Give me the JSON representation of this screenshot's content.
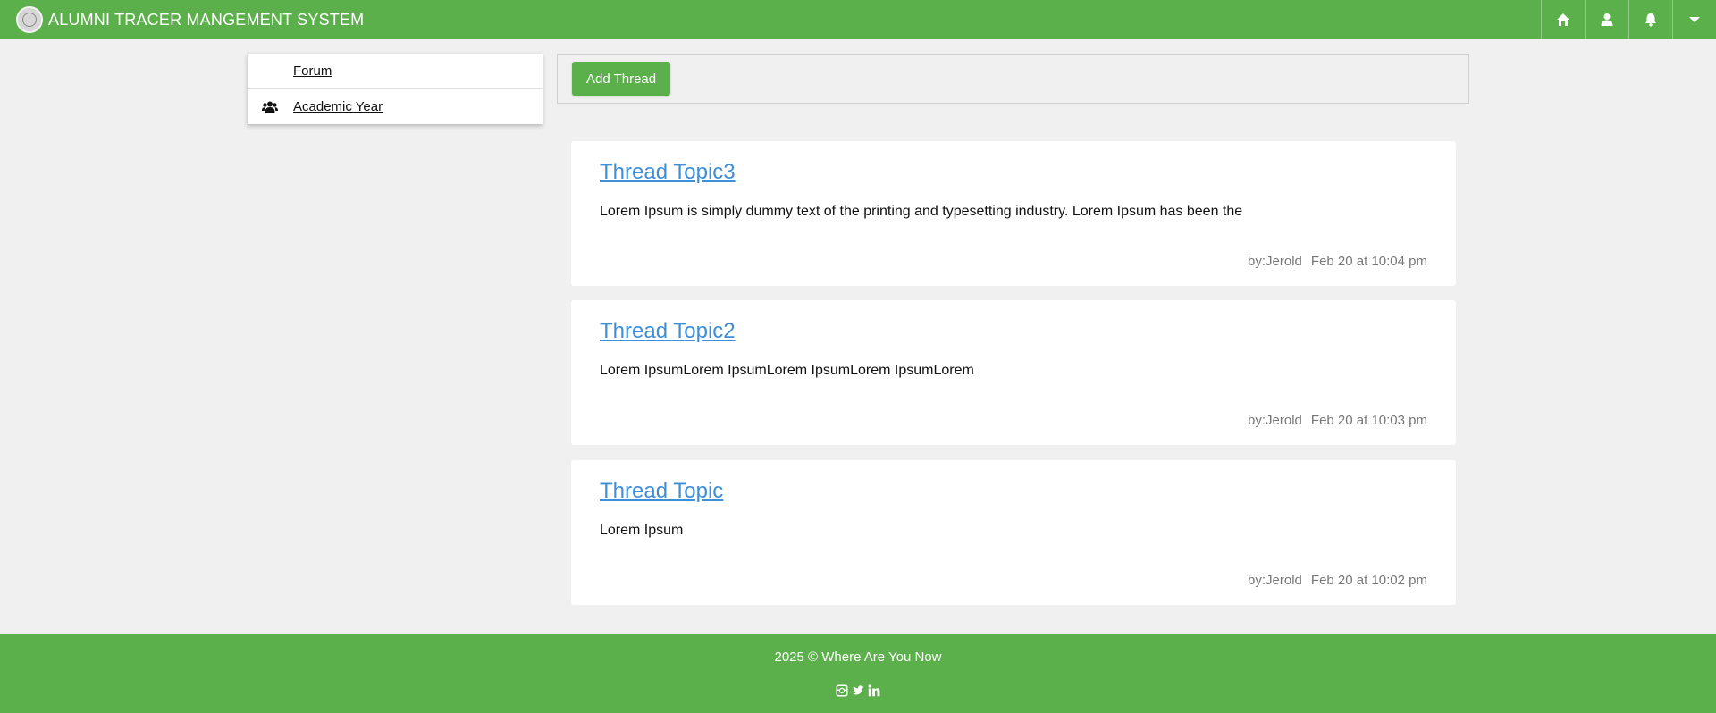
{
  "header": {
    "title": "ALUMNI TRACER MANGEMENT SYSTEM",
    "brand_color": "#5cb04b",
    "icons": [
      "home-icon",
      "user-icon",
      "bell-icon",
      "caret-down-icon"
    ]
  },
  "sidebar": {
    "items": [
      {
        "label": "Forum",
        "icon": ""
      },
      {
        "label": "Academic Year",
        "icon": "users-icon"
      }
    ]
  },
  "toolbar": {
    "add_thread_label": "Add Thread"
  },
  "threads": [
    {
      "title": "Thread Topic3",
      "body": "Lorem Ipsum is simply dummy text of the printing and typesetting industry. Lorem Ipsum has been the",
      "author": "by:Jerold",
      "date": "Feb 20 at 10:04 pm"
    },
    {
      "title": "Thread Topic2",
      "body": "Lorem IpsumLorem IpsumLorem IpsumLorem IpsumLorem",
      "author": "by:Jerold",
      "date": "Feb 20 at 10:03 pm"
    },
    {
      "title": "Thread Topic",
      "body": "Lorem Ipsum",
      "author": "by:Jerold",
      "date": "Feb 20 at 10:02 pm"
    }
  ],
  "footer": {
    "copyright": "2025 © Where Are You Now",
    "social_icons": [
      "instagram-icon",
      "twitter-icon",
      "linkedin-icon"
    ]
  },
  "colors": {
    "link": "#3f8fd8",
    "meta_text": "#777777",
    "background": "#f0f0f0"
  }
}
